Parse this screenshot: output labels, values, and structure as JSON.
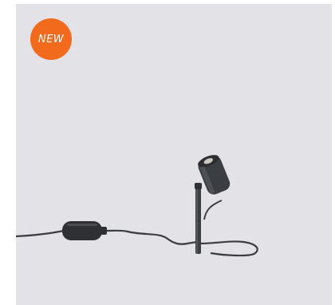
{
  "badge": {
    "label": "NEW",
    "color": "#f26a1b"
  },
  "card": {
    "background": "#e3e2e7"
  },
  "product": {
    "image": "outdoor-spotlight-with-cable-and-plug-icon",
    "body_color": "#3a3d42"
  }
}
